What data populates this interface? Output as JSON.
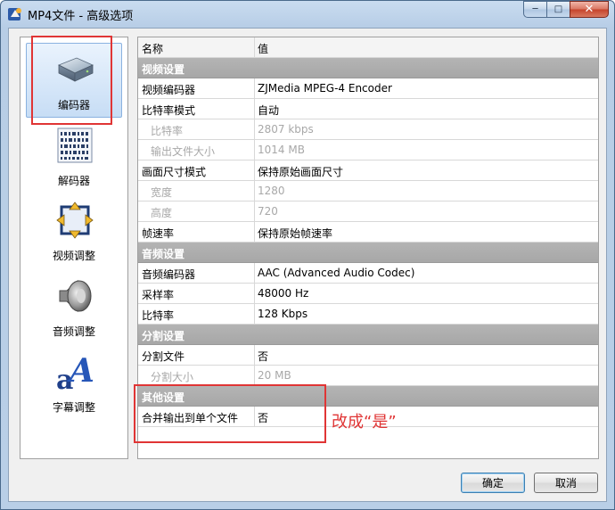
{
  "window": {
    "title": "MP4文件 - 高级选项",
    "min_label": "─",
    "max_label": "□",
    "close_label": "✕"
  },
  "sidebar": {
    "items": [
      {
        "label": "编码器",
        "icon": "encoder-box-icon",
        "selected": true
      },
      {
        "label": "解码器",
        "icon": "decoder-barcode-icon",
        "selected": false
      },
      {
        "label": "视频调整",
        "icon": "video-adjust-arrows-icon",
        "selected": false
      },
      {
        "label": "音频调整",
        "icon": "speaker-icon",
        "selected": false
      },
      {
        "label": "字幕调整",
        "icon": "subtitle-letter-a-icon",
        "selected": false
      }
    ]
  },
  "grid": {
    "header": {
      "name": "名称",
      "value": "值"
    },
    "rows": [
      {
        "kind": "group",
        "name": "视频设置",
        "value": ""
      },
      {
        "kind": "normal",
        "name": "视频编码器",
        "value": "ZJMedia MPEG-4 Encoder"
      },
      {
        "kind": "normal",
        "name": "比特率模式",
        "value": "自动"
      },
      {
        "kind": "disabled",
        "name": "比特率",
        "value": "2807 kbps"
      },
      {
        "kind": "disabled",
        "name": "输出文件大小",
        "value": "1014 MB"
      },
      {
        "kind": "normal",
        "name": "画面尺寸模式",
        "value": "保持原始画面尺寸"
      },
      {
        "kind": "disabled",
        "name": "宽度",
        "value": "1280"
      },
      {
        "kind": "disabled",
        "name": "高度",
        "value": "720"
      },
      {
        "kind": "normal",
        "name": "帧速率",
        "value": "保持原始帧速率"
      },
      {
        "kind": "group",
        "name": "音频设置",
        "value": ""
      },
      {
        "kind": "normal",
        "name": "音频编码器",
        "value": "AAC (Advanced Audio Codec)"
      },
      {
        "kind": "normal",
        "name": "采样率",
        "value": "48000 Hz"
      },
      {
        "kind": "normal",
        "name": "比特率",
        "value": "128 Kbps"
      },
      {
        "kind": "group",
        "name": "分割设置",
        "value": ""
      },
      {
        "kind": "normal",
        "name": "分割文件",
        "value": "否"
      },
      {
        "kind": "disabled",
        "name": "分割大小",
        "value": "20 MB"
      },
      {
        "kind": "group",
        "name": "其他设置",
        "value": ""
      },
      {
        "kind": "normal",
        "name": "合并输出到单个文件",
        "value": "否"
      }
    ]
  },
  "buttons": {
    "ok": "确定",
    "cancel": "取消"
  },
  "annotation": {
    "text": "改成“是”",
    "color": "#e03535"
  }
}
